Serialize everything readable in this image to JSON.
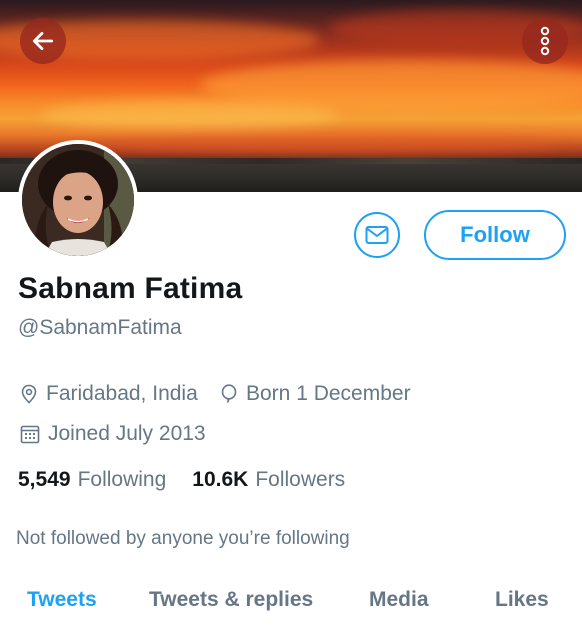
{
  "profile": {
    "name": "Sabnam Fatima",
    "handle": "@SabnamFatima",
    "location": "Faridabad, India",
    "birthday": "Born 1 December",
    "joined": "Joined July 2013",
    "following_count": "5,549",
    "following_label": "Following",
    "followers_count": "10.6K",
    "followers_label": "Followers",
    "follow_note": "Not followed by anyone you’re following"
  },
  "actions": {
    "follow_label": "Follow"
  },
  "tabs": [
    {
      "label": "Tweets",
      "active": true
    },
    {
      "label": "Tweets & replies",
      "active": false
    },
    {
      "label": "Media",
      "active": false
    },
    {
      "label": "Likes",
      "active": false
    }
  ],
  "colors": {
    "accent": "#1da1f2",
    "secondary_text": "#657786",
    "primary_text": "#14171a"
  },
  "icons": {
    "back": "back-arrow-icon",
    "more": "more-vertical-icon",
    "message": "envelope-icon",
    "location": "location-pin-icon",
    "birthday": "balloon-icon",
    "joined": "calendar-icon"
  }
}
